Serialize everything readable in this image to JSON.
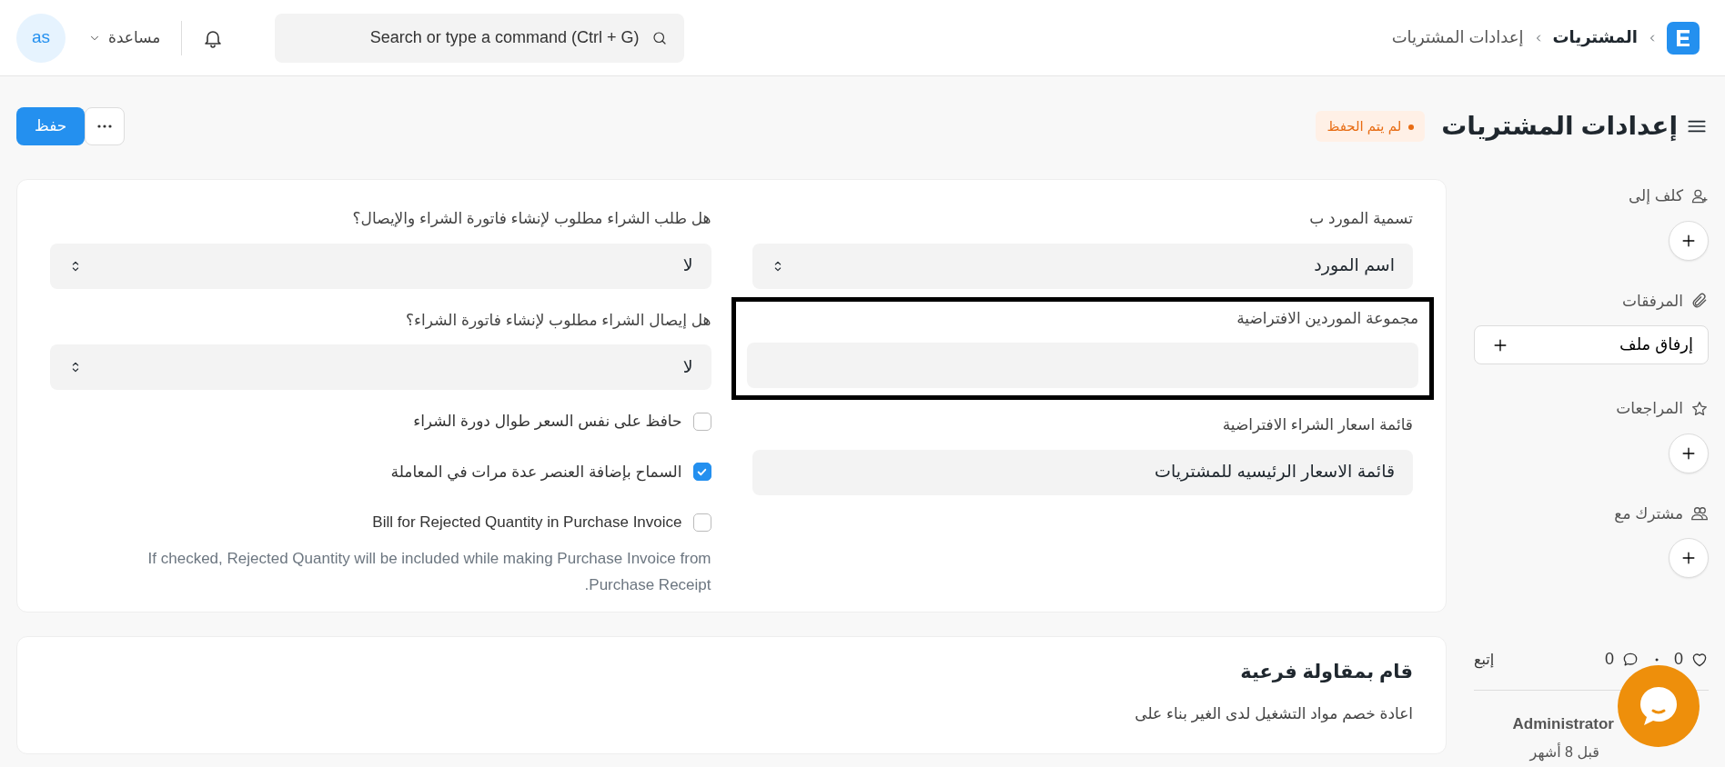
{
  "navbar": {
    "breadcrumbs": [
      {
        "label": "المشتريات"
      },
      {
        "label": "إعدادات المشتريات"
      }
    ],
    "search": {
      "placeholder": "Search or type a command (Ctrl + G)"
    },
    "help": "مساعدة",
    "avatar": "as"
  },
  "page": {
    "title": "إعدادات المشتريات",
    "status": "لم يتم الحفظ",
    "save": "حفظ"
  },
  "form": {
    "columns": [
      {
        "fields": [
          {
            "kind": "select",
            "label": "تسمية المورد ب",
            "value": "اسم المورد",
            "highlighted": false
          },
          {
            "kind": "link",
            "label": "مجموعة الموردين الافتراضية",
            "highlighted": true
          },
          {
            "kind": "link",
            "label": "قائمة اسعار الشراء الافتراضية",
            "value": "قائمة الاسعار الرئيسيه للمشتريات",
            "highlighted": false
          }
        ]
      },
      {
        "fields": [
          {
            "kind": "select",
            "label": "هل طلب الشراء مطلوب لإنشاء فاتورة الشراء والإيصال؟",
            "value": "لا",
            "highlighted": false
          },
          {
            "kind": "select",
            "label": "هل إيصال الشراء مطلوب لإنشاء فاتورة الشراء؟",
            "value": "لا",
            "highlighted": false
          },
          {
            "kind": "check",
            "label": "حافظ على نفس السعر طوال دورة الشراء",
            "checked": false
          },
          {
            "kind": "check",
            "label": "السماح بإضافة العنصر عدة مرات في المعاملة",
            "checked": true
          },
          {
            "kind": "check",
            "label": "Bill for Rejected Quantity in Purchase Invoice",
            "checked": false,
            "description": "If checked, Rejected Quantity will be included while making Purchase Invoice from Purchase Receipt."
          }
        ]
      }
    ]
  },
  "section": {
    "title": "قام بمقاولة فرعية",
    "label": "اعادة خصم مواد التشغيل لدى الغير بناء على"
  },
  "sidebar": {
    "sections": [
      {
        "kind": "assign",
        "label": "كلف إلى"
      },
      {
        "kind": "attachments",
        "label": "المرفقات",
        "button": "إرفاق ملف"
      },
      {
        "kind": "reviews",
        "label": "المراجعات"
      },
      {
        "kind": "shared",
        "label": "مشترك مع"
      }
    ],
    "likes": "0",
    "comments": "0",
    "follow": "إتبع",
    "activity": {
      "user": "Administrator",
      "time": "قبل 8 أشهر"
    }
  }
}
